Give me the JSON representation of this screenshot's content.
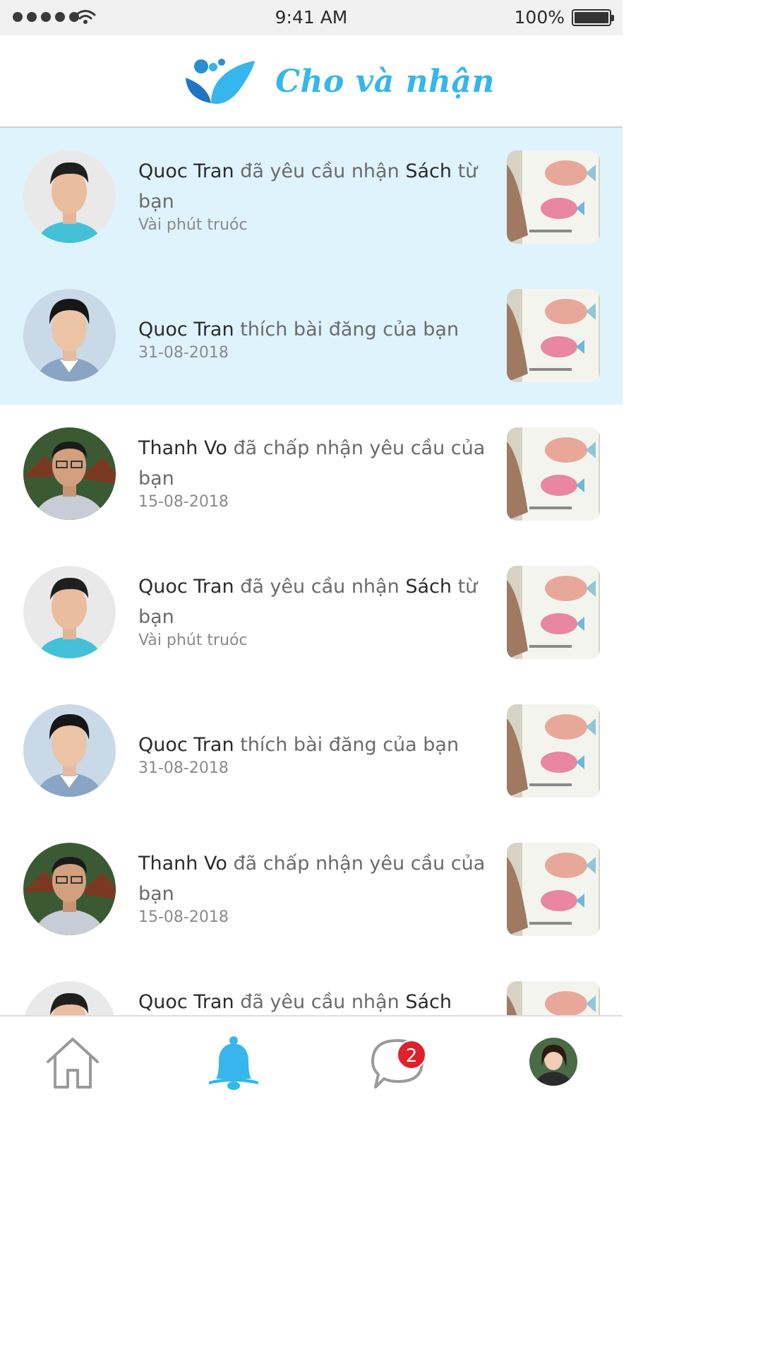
{
  "status_bar": {
    "time": "9:41 AM",
    "battery": "100%"
  },
  "header": {
    "app_name": "Cho và nhận"
  },
  "colors": {
    "accent": "#36b6ea",
    "unread_bg": "#dff3fc",
    "badge": "#e0202a"
  },
  "notifications": [
    {
      "name": "Quoc Tran",
      "action": "đã yêu cầu nhận",
      "object": "Sách",
      "tail": "từ bạn",
      "time": "Vài phút truóc",
      "unread": true
    },
    {
      "name": "Quoc Tran",
      "action": "thích bài đăng của bạn",
      "object": "",
      "tail": "",
      "time": "31-08-2018",
      "unread": true
    },
    {
      "name": "Thanh Vo",
      "action": "đã chấp nhận yêu cầu của bạn",
      "object": "",
      "tail": "",
      "time": "15-08-2018",
      "unread": false
    },
    {
      "name": "Quoc Tran",
      "action": "đã yêu cầu nhận",
      "object": "Sách",
      "tail": "từ bạn",
      "time": "Vài phút truóc",
      "unread": false
    },
    {
      "name": "Quoc Tran",
      "action": "thích bài đăng của bạn",
      "object": "",
      "tail": "",
      "time": "31-08-2018",
      "unread": false
    },
    {
      "name": "Thanh Vo",
      "action": "đã chấp nhận yêu cầu của bạn",
      "object": "",
      "tail": "",
      "time": "15-08-2018",
      "unread": false
    },
    {
      "name": "Quoc Tran",
      "action": "đã yêu cầu nhận",
      "object": "Sách",
      "tail": "",
      "time": "",
      "unread": false
    }
  ],
  "tabbar": {
    "tabs": [
      {
        "icon": "home-icon",
        "active": false
      },
      {
        "icon": "bell-icon",
        "active": true
      },
      {
        "icon": "chat-icon",
        "active": false,
        "badge": "2"
      },
      {
        "icon": "profile-avatar",
        "active": false
      }
    ]
  }
}
